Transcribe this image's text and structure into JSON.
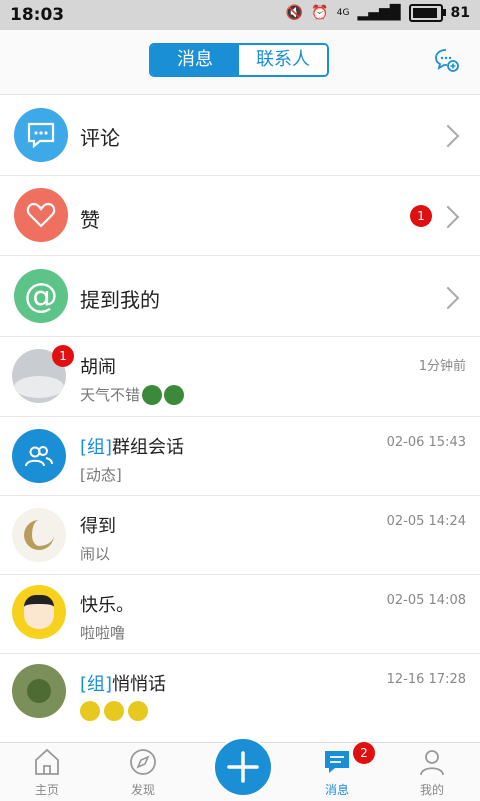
{
  "status": {
    "time": "18:03",
    "network": "4G",
    "battery": "81",
    "battery_level": 0.81
  },
  "header": {
    "tab_messages": "消息",
    "tab_contacts": "联系人"
  },
  "features": [
    {
      "label": "评论",
      "icon": "comment-icon",
      "color": "#3da9e8"
    },
    {
      "label": "赞",
      "icon": "heart-icon",
      "color": "#f07060",
      "badge": "1"
    },
    {
      "label": "提到我的",
      "icon": "at-icon",
      "color": "#5cc486"
    }
  ],
  "chats": [
    {
      "name": "胡闹",
      "message": "天气不错",
      "time": "1分钟前",
      "badge": "1"
    },
    {
      "tag": "[组]",
      "name": "群组会话",
      "message": "[动态]",
      "time": "02-06 15:43"
    },
    {
      "name": "得到",
      "message": "闹以",
      "time": "02-05 14:24"
    },
    {
      "name": "快乐。",
      "message": "啦啦噜",
      "time": "02-05 14:08"
    },
    {
      "tag": "[组]",
      "name": "悄悄话",
      "message": "",
      "time": "12-16 17:28"
    }
  ],
  "tabbar": {
    "home": "主页",
    "discover": "发现",
    "messages": "消息",
    "messages_badge": "2",
    "me": "我的"
  },
  "colors": {
    "accent": "#1a8fd6",
    "badge": "#e01010"
  }
}
